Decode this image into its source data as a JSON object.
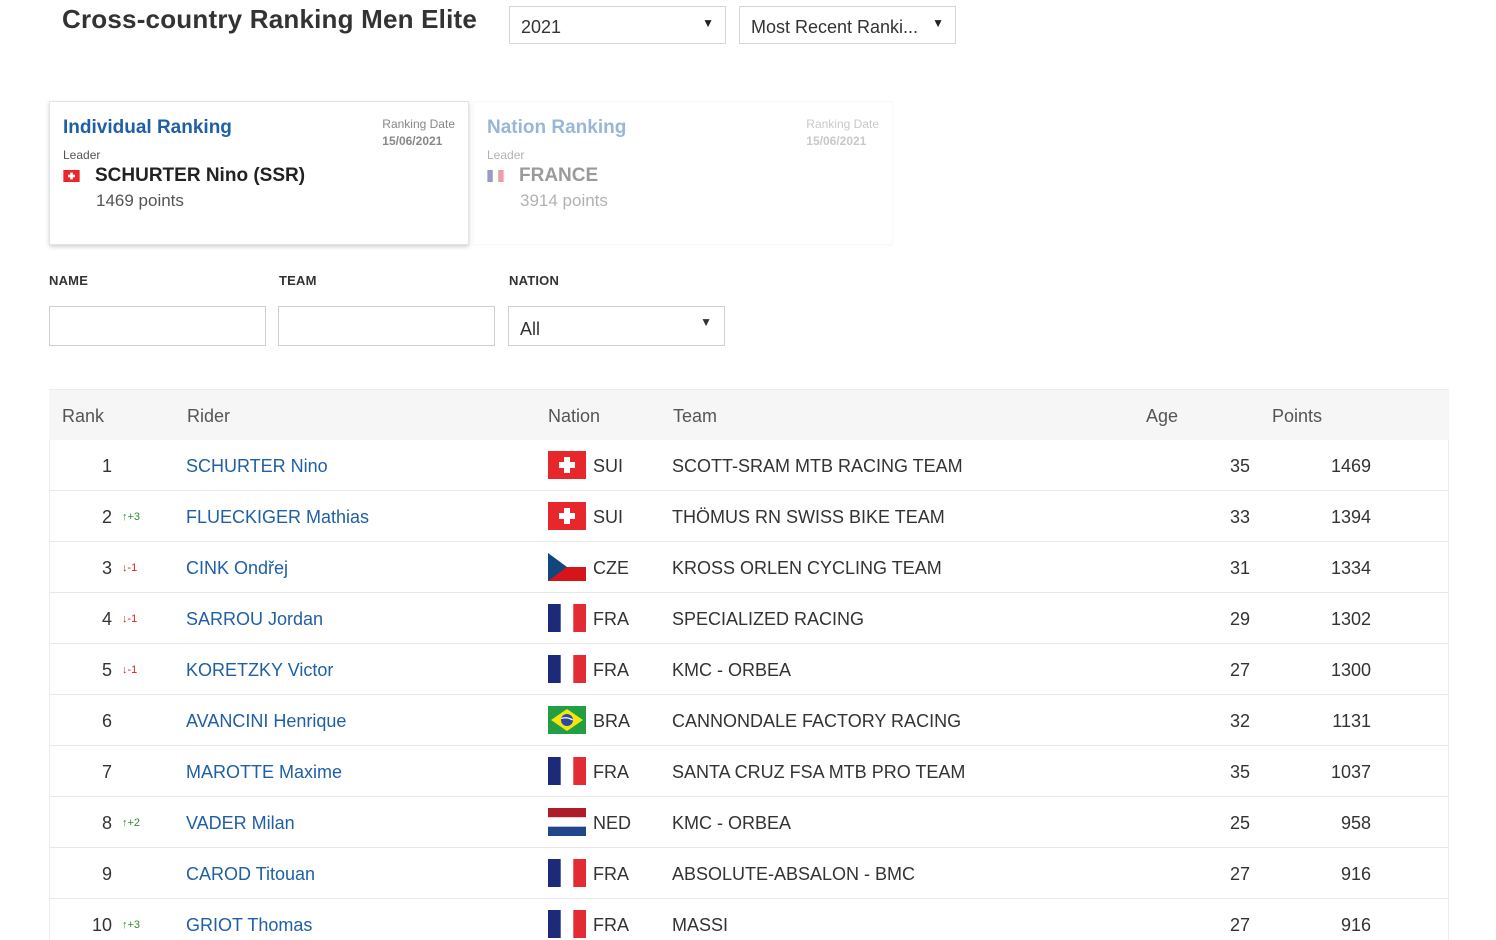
{
  "header": {
    "title": "Cross-country Ranking Men Elite",
    "year": "2021",
    "ranking_type": "Most Recent Ranki..."
  },
  "cards": {
    "individual": {
      "title": "Individual Ranking",
      "date_label": "Ranking Date",
      "date": "15/06/2021",
      "leader_label": "Leader",
      "leader": "SCHURTER Nino (SSR)",
      "points": "1469 points",
      "flag": "SUI"
    },
    "nation": {
      "title": "Nation Ranking",
      "date_label": "Ranking Date",
      "date": "15/06/2021",
      "leader_label": "Leader",
      "leader": "FRANCE",
      "points": "3914 points",
      "flag": "FRA"
    }
  },
  "filters": {
    "name_label": "NAME",
    "team_label": "TEAM",
    "nation_label": "NATION",
    "nation_value": "All"
  },
  "table": {
    "columns": {
      "rank": "Rank",
      "rider": "Rider",
      "nation": "Nation",
      "team": "Team",
      "age": "Age",
      "points": "Points"
    },
    "rows": [
      {
        "rank": "1",
        "move": "",
        "dir": "",
        "rider": "SCHURTER Nino",
        "nation": "SUI",
        "team": "SCOTT-SRAM MTB RACING TEAM",
        "age": "35",
        "points": "1469"
      },
      {
        "rank": "2",
        "move": "↑+3",
        "dir": "up",
        "rider": "FLUECKIGER Mathias",
        "nation": "SUI",
        "team": "THÖMUS RN SWISS BIKE TEAM",
        "age": "33",
        "points": "1394"
      },
      {
        "rank": "3",
        "move": "↓-1",
        "dir": "down",
        "rider": "CINK Ondřej",
        "nation": "CZE",
        "team": "KROSS ORLEN CYCLING TEAM",
        "age": "31",
        "points": "1334"
      },
      {
        "rank": "4",
        "move": "↓-1",
        "dir": "down",
        "rider": "SARROU Jordan",
        "nation": "FRA",
        "team": "SPECIALIZED RACING",
        "age": "29",
        "points": "1302"
      },
      {
        "rank": "5",
        "move": "↓-1",
        "dir": "down",
        "rider": "KORETZKY Victor",
        "nation": "FRA",
        "team": "KMC - ORBEA",
        "age": "27",
        "points": "1300"
      },
      {
        "rank": "6",
        "move": "",
        "dir": "",
        "rider": "AVANCINI Henrique",
        "nation": "BRA",
        "team": "CANNONDALE FACTORY RACING",
        "age": "32",
        "points": "1131"
      },
      {
        "rank": "7",
        "move": "",
        "dir": "",
        "rider": "MAROTTE Maxime",
        "nation": "FRA",
        "team": "SANTA CRUZ FSA MTB PRO TEAM",
        "age": "35",
        "points": "1037"
      },
      {
        "rank": "8",
        "move": "↑+2",
        "dir": "up",
        "rider": "VADER Milan",
        "nation": "NED",
        "team": "KMC - ORBEA",
        "age": "25",
        "points": "958"
      },
      {
        "rank": "9",
        "move": "",
        "dir": "",
        "rider": "CAROD Titouan",
        "nation": "FRA",
        "team": "ABSOLUTE-ABSALON - BMC",
        "age": "27",
        "points": "916"
      },
      {
        "rank": "10",
        "move": "↑+3",
        "dir": "up",
        "rider": "GRIOT Thomas",
        "nation": "FRA",
        "team": "MASSI",
        "age": "27",
        "points": "916"
      }
    ]
  },
  "colors": {
    "link": "#1f5fa6",
    "up": "#2e8b2e",
    "down": "#dd2222"
  }
}
